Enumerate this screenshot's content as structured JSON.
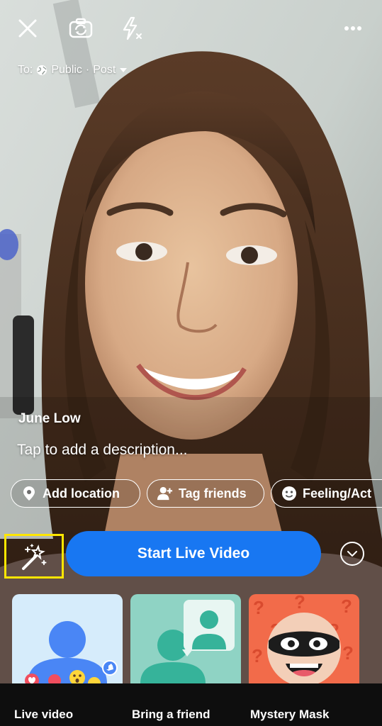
{
  "topbar": {
    "close_icon": "close-icon",
    "flip_icon": "camera-flip-icon",
    "flash_icon": "flash-off-icon",
    "more_icon": "more-dots-icon"
  },
  "audience": {
    "prefix": "To:",
    "privacy": "Public",
    "separator": "·",
    "destination": "Post"
  },
  "broadcaster": {
    "name": "June Low"
  },
  "description": {
    "placeholder": "Tap to add a description..."
  },
  "chips": [
    {
      "label": "Add location",
      "icon": "location-pin-icon"
    },
    {
      "label": "Tag friends",
      "icon": "tag-friends-icon"
    },
    {
      "label": "Feeling/Act",
      "icon": "smiley-icon"
    }
  ],
  "actions": {
    "start_label": "Start Live Video",
    "effects_icon": "magic-wand-icon",
    "more_options_icon": "chevron-down-icon"
  },
  "formats": [
    {
      "label": "Live video"
    },
    {
      "label": "Bring a friend"
    },
    {
      "label": "Mystery Mask"
    }
  ],
  "colors": {
    "primary": "#1877f2",
    "highlight": "#ffe600",
    "live_card_bg": "#d6ecfb",
    "friend_card_bg": "#8fd3c4",
    "mask_card_bg": "#f26b4a"
  }
}
